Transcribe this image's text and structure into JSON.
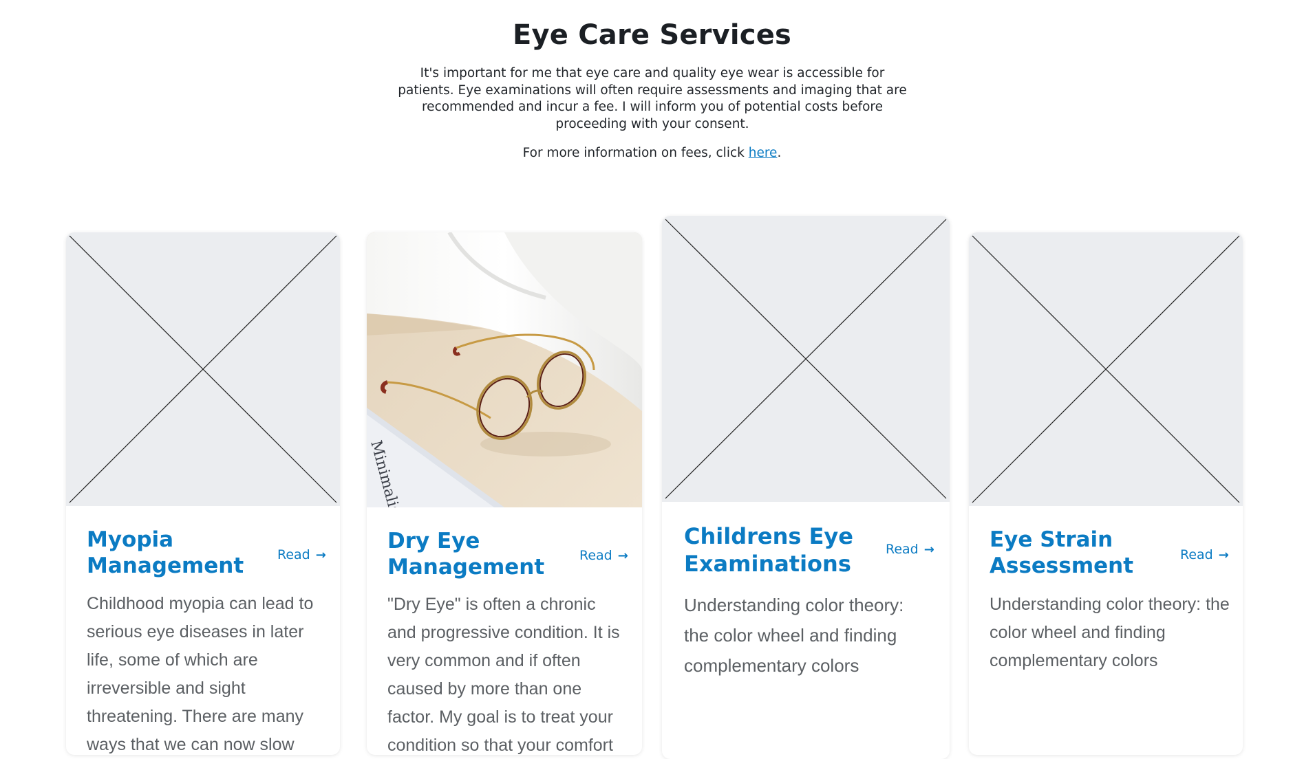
{
  "header": {
    "title": "Eye Care Services",
    "intro": "It's important for me that eye care and quality eye wear is accessible for patients. Eye examinations will often require assessments and imaging that are recommended and incur a fee. I will inform you of potential costs before proceeding with your consent.",
    "fees_prefix": "For more information on fees, click ",
    "fees_link": "here",
    "fees_suffix": "."
  },
  "colors": {
    "accent": "#0b7bc3",
    "placeholder_bg": "#ebedf0",
    "body_text": "#5b5f63"
  },
  "cards": [
    {
      "image": "placeholder-image",
      "title": "Myopia Management",
      "read_label": "Read",
      "arrow_icon": "arrow-right-icon",
      "description": "Childhood myopia can lead to serious eye diseases in later life, some of which are irreversible and sight threatening. There are many ways that we can now slow"
    },
    {
      "image": "eyeglasses-photo",
      "title": "Dry Eye Management",
      "read_label": "Read",
      "arrow_icon": "arrow-right-icon",
      "description": "\"Dry Eye\" is often a chronic and progressive condition. It is very common and if often caused by more than one factor. My goal is to treat your condition so that your comfort",
      "photo_book_text": "Minimalism"
    },
    {
      "image": "placeholder-image",
      "title": "Childrens Eye Examinations",
      "read_label": "Read",
      "arrow_icon": "arrow-right-icon",
      "description": "Understanding color theory: the color wheel and finding complementary colors"
    },
    {
      "image": "placeholder-image",
      "title": "Eye Strain Assessment",
      "read_label": "Read",
      "arrow_icon": "arrow-right-icon",
      "description": "Understanding color theory: the color wheel and finding complementary colors"
    }
  ]
}
